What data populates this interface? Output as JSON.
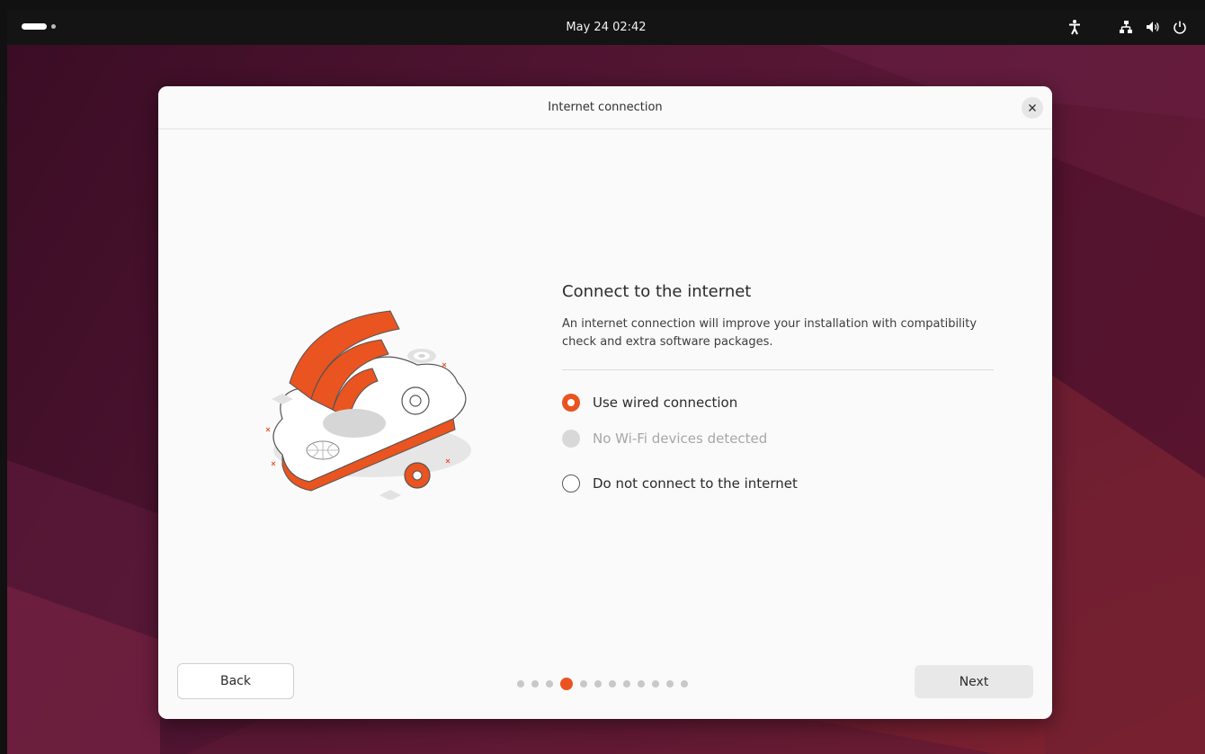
{
  "topbar": {
    "clock": "May 24  02:42",
    "icons": [
      "activities-indicator",
      "accessibility-icon",
      "network-wired-icon",
      "volume-icon",
      "power-icon"
    ]
  },
  "dialog": {
    "title": "Internet connection",
    "heading": "Connect to the internet",
    "description": "An internet connection will improve your installation with compatibility check and extra software packages.",
    "options": [
      {
        "label": "Use wired connection",
        "state": "selected"
      },
      {
        "label": "No Wi-Fi devices detected",
        "state": "disabled"
      },
      {
        "label": "Do not connect to the internet",
        "state": "unselected"
      }
    ],
    "back_label": "Back",
    "next_label": "Next",
    "pager": {
      "total": 12,
      "current": 4
    }
  },
  "colors": {
    "accent": "#e95420",
    "topbar": "#141414",
    "dialog_bg": "#fafafa"
  }
}
